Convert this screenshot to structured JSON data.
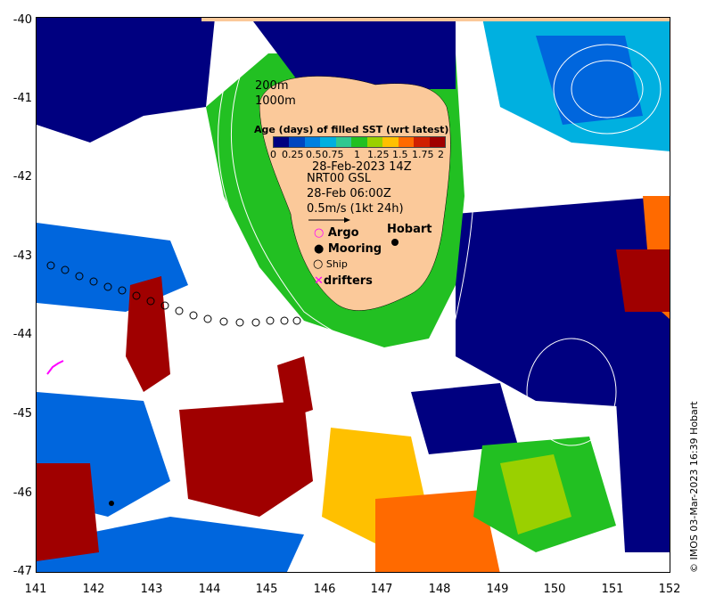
{
  "map": {
    "lat_labels": [
      "-40",
      "-41",
      "-42",
      "-43",
      "-44",
      "-45",
      "-46",
      "-47"
    ],
    "lon_labels": [
      "141",
      "142",
      "143",
      "144",
      "145",
      "146",
      "147",
      "148",
      "149",
      "150",
      "151",
      "152"
    ],
    "colors": {
      "land": "#fbc99a",
      "age_0": "#000080",
      "age_025": "#0066dd",
      "age_05": "#00b0e0",
      "age_075": "#30c890",
      "age_1": "#22c022",
      "age_125": "#9ad000",
      "age_15": "#ffc000",
      "age_175": "#ff6a00",
      "age_2": "#a00000",
      "no_data": "#ffffff"
    }
  },
  "overlay": {
    "depth_200": "200m",
    "depth_1000": "1000m",
    "colorbar_title": "Age (days) of filled SST (wrt latest)",
    "colorbar_ticks": [
      "0",
      "0.25",
      "0.5",
      "0.75",
      "1",
      "1.25",
      "1.5",
      "1.75",
      "2"
    ],
    "date": "28-Feb-2023 14Z",
    "current_source": "NRT00 GSL",
    "current_date": "28-Feb 06:00Z",
    "scale_label": "0.5m/s (1kt 24h)",
    "argo": "Argo",
    "mooring": "Mooring",
    "ship": "Ship",
    "drifters": "drifters",
    "city": "Hobart"
  },
  "credit": "© IMOS 03-Mar-2023 16:39 Hobart"
}
